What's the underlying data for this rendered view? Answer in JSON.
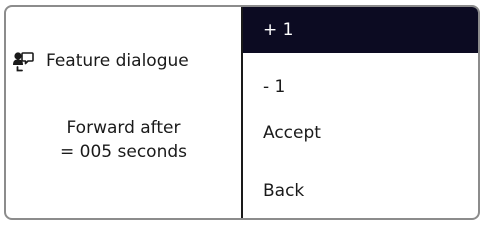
{
  "dialog": {
    "title": "Feature dialogue",
    "icon": "feature-dialogue-icon",
    "message_line1": "Forward after",
    "message_line2": "= 005 seconds"
  },
  "menu": {
    "items": [
      {
        "label": "+ 1",
        "selected": true
      },
      {
        "label": "- 1",
        "selected": false
      },
      {
        "label": "Accept",
        "selected": false
      },
      {
        "label": "Back",
        "selected": false
      }
    ]
  },
  "colors": {
    "selection_background": "#0c0b22",
    "selection_text": "#ffffff",
    "text": "#1a1a1a",
    "border": "#8c8c8c"
  }
}
